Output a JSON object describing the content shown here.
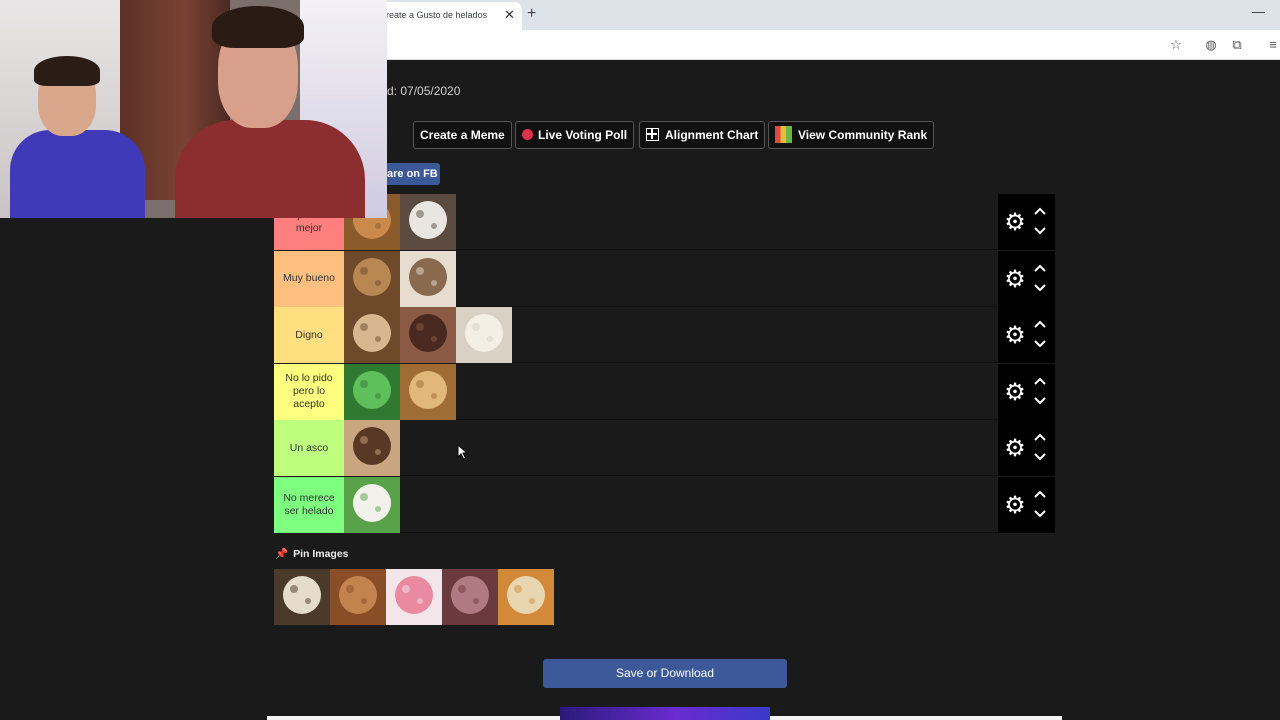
{
  "browser": {
    "tab_title": "reate a Gusto de helados en A",
    "tab_close": "✕",
    "new_tab": "+",
    "minimize": "—"
  },
  "page": {
    "date_text": "d: 07/05/2020",
    "share_label": "are on FB",
    "buttons": [
      {
        "label": "Create a Meme",
        "icon": "none"
      },
      {
        "label": "Live Voting Poll",
        "icon": "record-dot"
      },
      {
        "label": "Alignment Chart",
        "icon": "grid"
      },
      {
        "label": "View Community Rank",
        "icon": "mosaic"
      }
    ]
  },
  "tiers": [
    {
      "label": "Mejor de lo mejor",
      "color": "#ff7f7f",
      "items": [
        "caramel ice cream",
        "cookies and cream ice cream"
      ]
    },
    {
      "label": "Muy bueno",
      "color": "#ffbf7f",
      "items": [
        "dulce de leche ice cream",
        "coffee ice cream"
      ]
    },
    {
      "label": "Digno",
      "color": "#ffdf7f",
      "items": [
        "granola ice cream",
        "chocolate ice cream",
        "vanilla ice cream"
      ]
    },
    {
      "label": "No lo pido pero lo acepto",
      "color": "#ffff7f",
      "items": [
        "mint ice cream",
        "cream ice cream"
      ]
    },
    {
      "label": "Un asco",
      "color": "#bfff7f",
      "items": [
        "chocolate chip ice cream"
      ]
    },
    {
      "label": "No merece ser helado",
      "color": "#7fff7f",
      "items": [
        "lemon mint ice cream"
      ]
    }
  ],
  "pin_images_label": "Pin Images",
  "pool_items": [
    "stracciatella ice cream",
    "hazelnut ice cream",
    "strawberry ice cream",
    "chocolate chip cookie ice cream",
    "tramontana ice cream"
  ],
  "save_label": "Save or Download",
  "controls": {
    "gear": "⚙",
    "up": "⌃",
    "down": "⌄"
  }
}
